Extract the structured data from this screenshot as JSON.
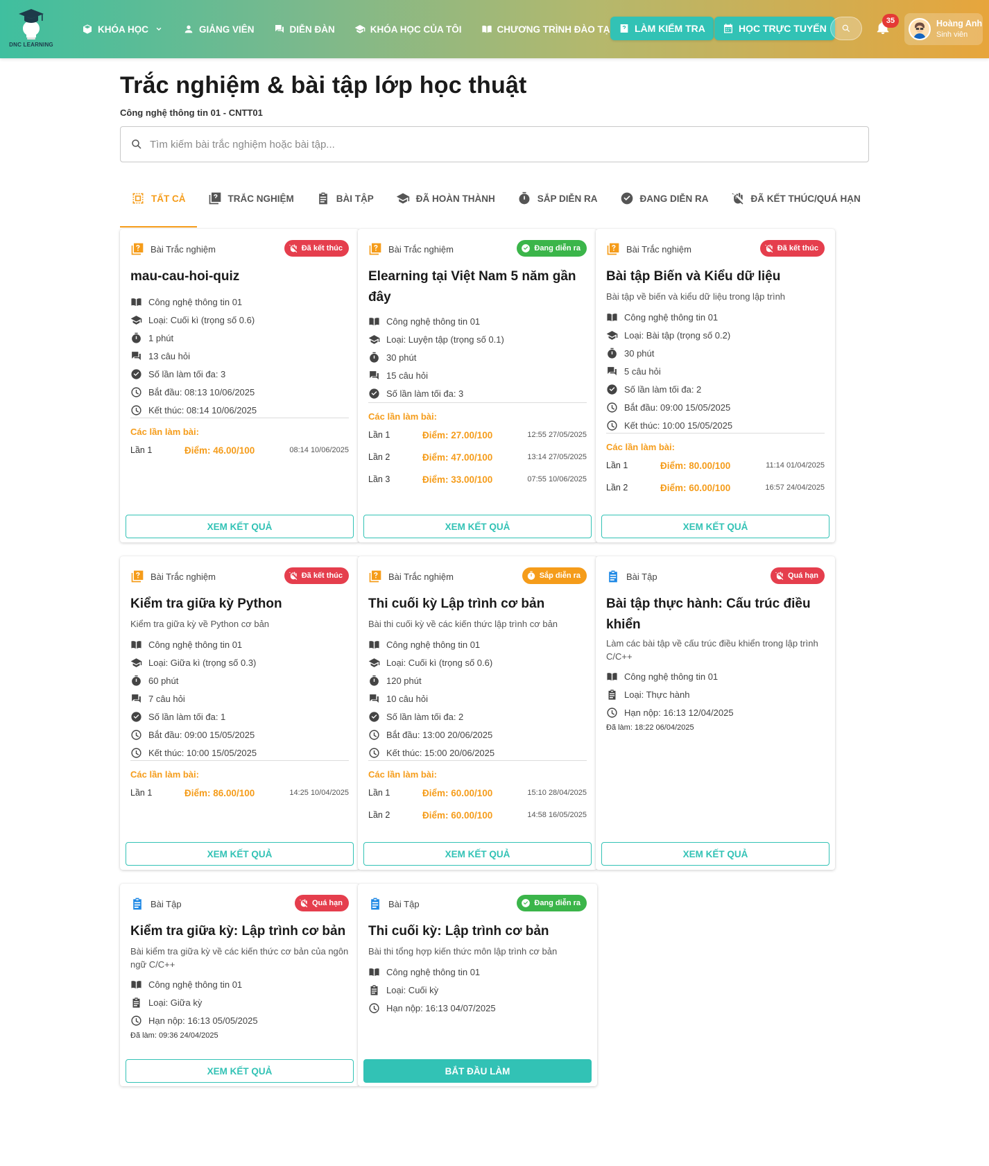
{
  "brand": {
    "name": "DNC LEARNING"
  },
  "nav": [
    {
      "label": "KHÓA HỌC",
      "icon": "box-icon",
      "dropdown": true
    },
    {
      "label": "GIẢNG VIÊN",
      "icon": "person-icon"
    },
    {
      "label": "DIỄN ĐÀN",
      "icon": "forum-icon"
    },
    {
      "label": "KHÓA HỌC CỦA TÔI",
      "icon": "graduation-cap-icon"
    },
    {
      "label": "CHƯƠNG TRÌNH ĐÀO TẠO",
      "icon": "book-open-icon"
    }
  ],
  "header_buttons": {
    "test": "LÀM KIỂM TRA",
    "online": "HỌC TRỰC TUYẾN"
  },
  "notifications": {
    "count": "35"
  },
  "user": {
    "name": "Hoàng Anh",
    "role": "Sinh viên"
  },
  "page": {
    "title": "Trắc nghiệm & bài tập lớp học thuật",
    "subtitle": "Công nghệ thông tin 01 - CNTT01",
    "search_placeholder": "Tìm kiếm bài trắc nghiệm hoặc bài tập..."
  },
  "tabs": [
    {
      "label": "TẤT CẢ",
      "icon": "select-all-icon",
      "active": true
    },
    {
      "label": "TRẮC NGHIỆM",
      "icon": "quiz-icon"
    },
    {
      "label": "BÀI TẬP",
      "icon": "assignment-icon"
    },
    {
      "label": "ĐÃ HOÀN THÀNH",
      "icon": "graduation-cap-icon"
    },
    {
      "label": "SẮP DIỄN RA",
      "icon": "timer-icon"
    },
    {
      "label": "ĐANG DIỄN RA",
      "icon": "check-circle-icon"
    },
    {
      "label": "ĐÃ KẾT THÚC/QUÁ HẠN",
      "icon": "hand-stop-icon"
    }
  ],
  "attempts_heading": "Các lần làm bài:",
  "cards": [
    {
      "kind": "Bài Trắc nghiệm",
      "status": "Đã kết thúc",
      "title": "mau-cau-hoi-quiz",
      "info": [
        "Công nghệ thông tin 01",
        "Loại: Cuối kì (trọng số 0.6)",
        "1 phút",
        "13 câu hỏi",
        "Số lần làm tối đa: 3",
        "Bắt đầu: 08:13 10/06/2025",
        "Kết thúc: 08:14 10/06/2025"
      ],
      "attempts": [
        {
          "n": "Lần 1",
          "score": "Điểm: 46.00/100",
          "time": "08:14 10/06/2025"
        }
      ],
      "button": "XEM KẾT QUẢ"
    },
    {
      "kind": "Bài Trắc nghiệm",
      "status": "Đang diễn ra",
      "title": "Elearning tại Việt Nam 5 năm gần đây",
      "info": [
        "Công nghệ thông tin 01",
        "Loại: Luyện tập (trọng số 0.1)",
        "30 phút",
        "15 câu hỏi",
        "Số lần làm tối đa: 3"
      ],
      "attempts": [
        {
          "n": "Lần 1",
          "score": "Điểm: 27.00/100",
          "time": "12:55 27/05/2025"
        },
        {
          "n": "Lần 2",
          "score": "Điểm: 47.00/100",
          "time": "13:14 27/05/2025"
        },
        {
          "n": "Lần 3",
          "score": "Điểm: 33.00/100",
          "time": "07:55 10/06/2025"
        }
      ],
      "button": "XEM KẾT QUẢ"
    },
    {
      "kind": "Bài Trắc nghiệm",
      "status": "Đã kết thúc",
      "title": "Bài tập Biến và Kiểu dữ liệu",
      "desc": "Bài tập về biến và kiểu dữ liệu trong lập trình",
      "info": [
        "Công nghệ thông tin 01",
        "Loại: Bài tập (trọng số 0.2)",
        "30 phút",
        "5 câu hỏi",
        "Số lần làm tối đa: 2",
        "Bắt đầu: 09:00 15/05/2025",
        "Kết thúc: 10:00 15/05/2025"
      ],
      "attempts": [
        {
          "n": "Lần 1",
          "score": "Điểm: 80.00/100",
          "time": "11:14 01/04/2025"
        },
        {
          "n": "Lần 2",
          "score": "Điểm: 60.00/100",
          "time": "16:57 24/04/2025"
        }
      ],
      "button": "XEM KẾT QUẢ"
    },
    {
      "kind": "Bài Trắc nghiệm",
      "status": "Đã kết thúc",
      "title": "Kiểm tra giữa kỳ Python",
      "desc": "Kiểm tra giữa kỳ về Python cơ bản",
      "info": [
        "Công nghệ thông tin 01",
        "Loại: Giữa kì (trọng số 0.3)",
        "60 phút",
        "7 câu hỏi",
        "Số lần làm tối đa: 1",
        "Bắt đầu: 09:00 15/05/2025",
        "Kết thúc: 10:00 15/05/2025"
      ],
      "attempts": [
        {
          "n": "Lần 1",
          "score": "Điểm: 86.00/100",
          "time": "14:25 10/04/2025"
        }
      ],
      "button": "XEM KẾT QUẢ"
    },
    {
      "kind": "Bài Trắc nghiệm",
      "status": "Sắp diễn ra",
      "title": "Thi cuối kỳ Lập trình cơ bản",
      "desc": "Bài thi cuối kỳ về các kiến thức lập trình cơ bản",
      "info": [
        "Công nghệ thông tin 01",
        "Loại: Cuối kì (trọng số 0.6)",
        "120 phút",
        "10 câu hỏi",
        "Số lần làm tối đa: 2",
        "Bắt đầu: 13:00 20/06/2025",
        "Kết thúc: 15:00 20/06/2025"
      ],
      "attempts": [
        {
          "n": "Lần 1",
          "score": "Điểm: 60.00/100",
          "time": "15:10 28/04/2025"
        },
        {
          "n": "Lần 2",
          "score": "Điểm: 60.00/100",
          "time": "14:58 16/05/2025"
        }
      ],
      "button": "XEM KẾT QUẢ"
    },
    {
      "kind": "Bài Tập",
      "status": "Quá hạn",
      "title": "Bài tập thực hành: Cấu trúc điều khiển",
      "desc": "Làm các bài tập về cấu trúc điều khiển trong lập trình C/C++",
      "info": [
        "Công nghệ thông tin 01",
        "Loại: Thực hành",
        "Hạn nộp: 16:13 12/04/2025"
      ],
      "done_at": "Đã làm: 18:22 06/04/2025",
      "button": "XEM KẾT QUẢ"
    },
    {
      "kind": "Bài Tập",
      "status": "Quá hạn",
      "title": "Kiểm tra giữa kỳ: Lập trình cơ bản",
      "desc": "Bài kiểm tra giữa kỳ về các kiến thức cơ bản của ngôn ngữ C/C++",
      "info": [
        "Công nghệ thông tin 01",
        "Loại: Giữa kỳ",
        "Hạn nộp: 16:13 05/05/2025"
      ],
      "done_at": "Đã làm: 09:36 24/04/2025",
      "button": "XEM KẾT QUẢ"
    },
    {
      "kind": "Bài Tập",
      "status": "Đang diễn ra",
      "title": "Thi cuối kỳ: Lập trình cơ bản",
      "desc": "Bài thi tổng hợp kiến thức môn lập trình cơ bản",
      "info": [
        "Công nghệ thông tin 01",
        "Loại: Cuối kỳ",
        "Hạn nộp: 16:13 04/07/2025"
      ],
      "button": "BẮT ĐẦU LÀM"
    }
  ],
  "colors": {
    "accent": "#32c2b5",
    "orange": "#f59c1a",
    "red": "#e53e4d",
    "green": "#3bb54a"
  }
}
